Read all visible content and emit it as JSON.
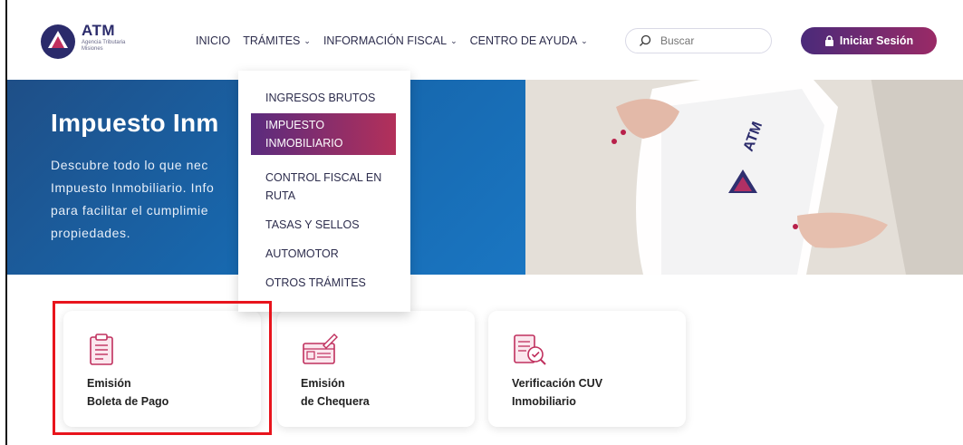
{
  "header": {
    "brand_name": "ATM",
    "brand_sub": "Agencia Tributaria Misiones",
    "nav": [
      {
        "label": "INICIO",
        "chevron": false
      },
      {
        "label": "TRÁMITES",
        "chevron": true
      },
      {
        "label": "INFORMACIÓN FISCAL",
        "chevron": true
      },
      {
        "label": "CENTRO DE AYUDA",
        "chevron": true
      }
    ],
    "search_placeholder": "Buscar",
    "login_label": "Iniciar Sesión"
  },
  "hero": {
    "title": "Impuesto Inm",
    "lines": [
      "Descubre todo lo que nec",
      "Impuesto Inmobiliario. Info",
      "para facilitar el cumplimie",
      "propiedades."
    ]
  },
  "dropdown": {
    "items": [
      {
        "label": "INGRESOS BRUTOS",
        "active": false
      },
      {
        "label": "IMPUESTO INMOBILIARIO",
        "lines": [
          "IMPUESTO",
          "INMOBILIARIO"
        ],
        "active": true
      },
      {
        "label": "CONTROL FISCAL EN RUTA",
        "lines": [
          "CONTROL FISCAL EN",
          "RUTA"
        ],
        "active": false
      },
      {
        "label": "TASAS Y SELLOS",
        "active": false
      },
      {
        "label": "AUTOMOTOR",
        "active": false
      },
      {
        "label": "OTROS TRÁMITES",
        "active": false
      }
    ]
  },
  "cards": [
    {
      "line1": "Emisión",
      "line2": "Boleta de Pago",
      "icon": "receipt-icon"
    },
    {
      "line1": "Emisión",
      "line2": "de Chequera",
      "icon": "checkbook-icon"
    },
    {
      "line1": "Verificación CUV",
      "line2": "Inmobiliario",
      "icon": "document-check-icon"
    }
  ],
  "colors": {
    "accent_gradient_start": "#4a2a7a",
    "accent_gradient_end": "#9a2a66",
    "hero_blue": "#1769b0",
    "icon_color": "#c0305e",
    "highlight_red": "#e8141c"
  }
}
